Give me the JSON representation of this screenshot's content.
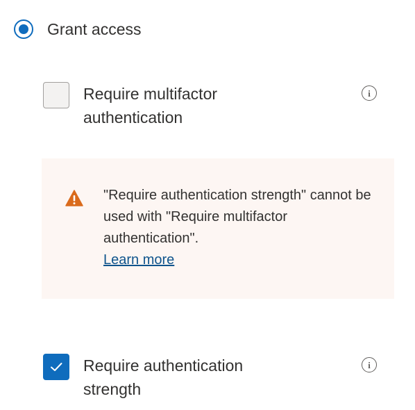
{
  "grant": {
    "label": "Grant access",
    "selected": true
  },
  "controls": {
    "mfa": {
      "label": "Require multifactor authentication",
      "checked": false,
      "info_icon": "info-icon"
    },
    "strength": {
      "label": "Require authentication strength",
      "checked": true,
      "info_icon": "info-icon"
    }
  },
  "warning": {
    "icon": "warning-icon",
    "message": "\"Require authentication strength\" cannot be used with \"Require multifactor authentication\".",
    "link_label": "Learn more"
  },
  "colors": {
    "accent": "#0f6cbd",
    "warning_bg": "#fdf6f3",
    "warning_icon": "#da6b1c",
    "link": "#0f548c"
  }
}
